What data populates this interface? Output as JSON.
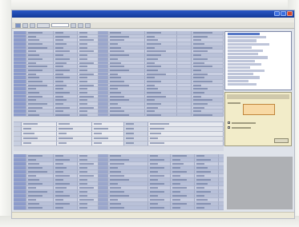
{
  "window": {
    "title": "",
    "menus": []
  },
  "toolbar": {
    "buttons": [
      "back-icon",
      "forward-icon",
      "refresh-icon",
      "save-icon",
      "print-icon",
      "filter-icon"
    ]
  },
  "grid": {
    "rows": 24
  },
  "middle_section": {
    "title": "",
    "rows": 5
  },
  "right_panel": {
    "list_items": 16,
    "selected_index": 0
  },
  "bottom_grid": {
    "rows": 14
  },
  "status": {
    "left": "",
    "right": ""
  },
  "colors": {
    "titlebar": "#123a98",
    "grid_bg": "#c2c9dd",
    "panel_bg": "#f2ecc9",
    "taskbar_bg": "#ece9d8"
  }
}
